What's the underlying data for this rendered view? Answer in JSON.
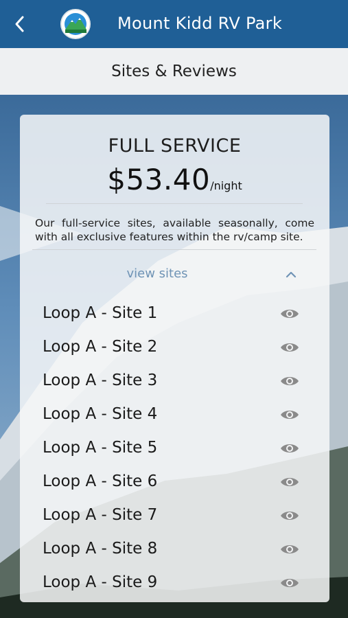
{
  "header": {
    "title": "Mount Kidd RV Park",
    "back_icon": "chevron-left-icon",
    "logo": "park-logo"
  },
  "subheader": {
    "title": "Sites & Reviews"
  },
  "card": {
    "service_name": "FULL SERVICE",
    "price": "$53.40",
    "price_unit": "/night",
    "description": "Our full-service sites, available seasonally, come with all exclusive features within the rv/camp site.",
    "toggle_label": "view sites",
    "toggle_icon": "chevron-up-icon",
    "sites": [
      {
        "label": "Loop A - Site 1",
        "icon": "eye-icon"
      },
      {
        "label": "Loop A - Site 2",
        "icon": "eye-icon"
      },
      {
        "label": "Loop A - Site 3",
        "icon": "eye-icon"
      },
      {
        "label": "Loop A - Site 4",
        "icon": "eye-icon"
      },
      {
        "label": "Loop A - Site 5",
        "icon": "eye-icon"
      },
      {
        "label": "Loop A - Site 6",
        "icon": "eye-icon"
      },
      {
        "label": "Loop A - Site 7",
        "icon": "eye-icon"
      },
      {
        "label": "Loop A - Site 8",
        "icon": "eye-icon"
      },
      {
        "label": "Loop A - Site 9",
        "icon": "eye-icon"
      }
    ]
  },
  "colors": {
    "header_bg": "#1f5f96",
    "subheader_bg": "#eef0f2",
    "link": "#6f93b5",
    "icon_gray": "#8a8a8a"
  }
}
